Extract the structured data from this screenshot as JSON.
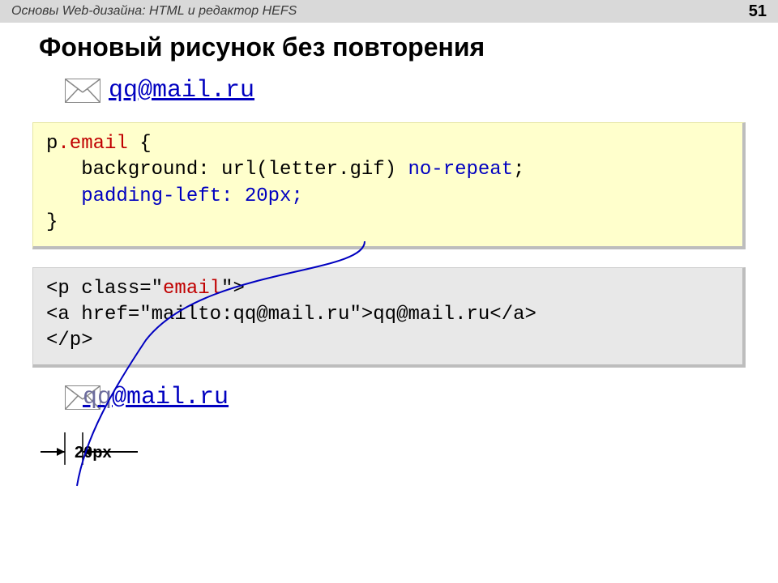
{
  "header": {
    "title": "Основы Web-дизайна: HTML и редактор HEFS",
    "page": "51"
  },
  "slide_title": "Фоновый рисунок без повторения",
  "example1": {
    "email": "qq@mail.ru"
  },
  "css": {
    "sel_tag": "p",
    "sel_class": ".email",
    "brace_open": " {",
    "line2_a": "   background: url(letter.gif) ",
    "line2_b": "no-repeat",
    "line2_c": ";",
    "line3": "   padding-left: 20px;",
    "brace_close": "}"
  },
  "html": {
    "l1_a": "<p class=\"",
    "l1_b": "email",
    "l1_c": "\">",
    "l2": "<a href=\"mailto:qq@mail.ru\">qq@mail.ru</a>",
    "l3": "</p>"
  },
  "example2": {
    "qq": "qq",
    "rest": "@mail.ru"
  },
  "measure_label": "20px"
}
